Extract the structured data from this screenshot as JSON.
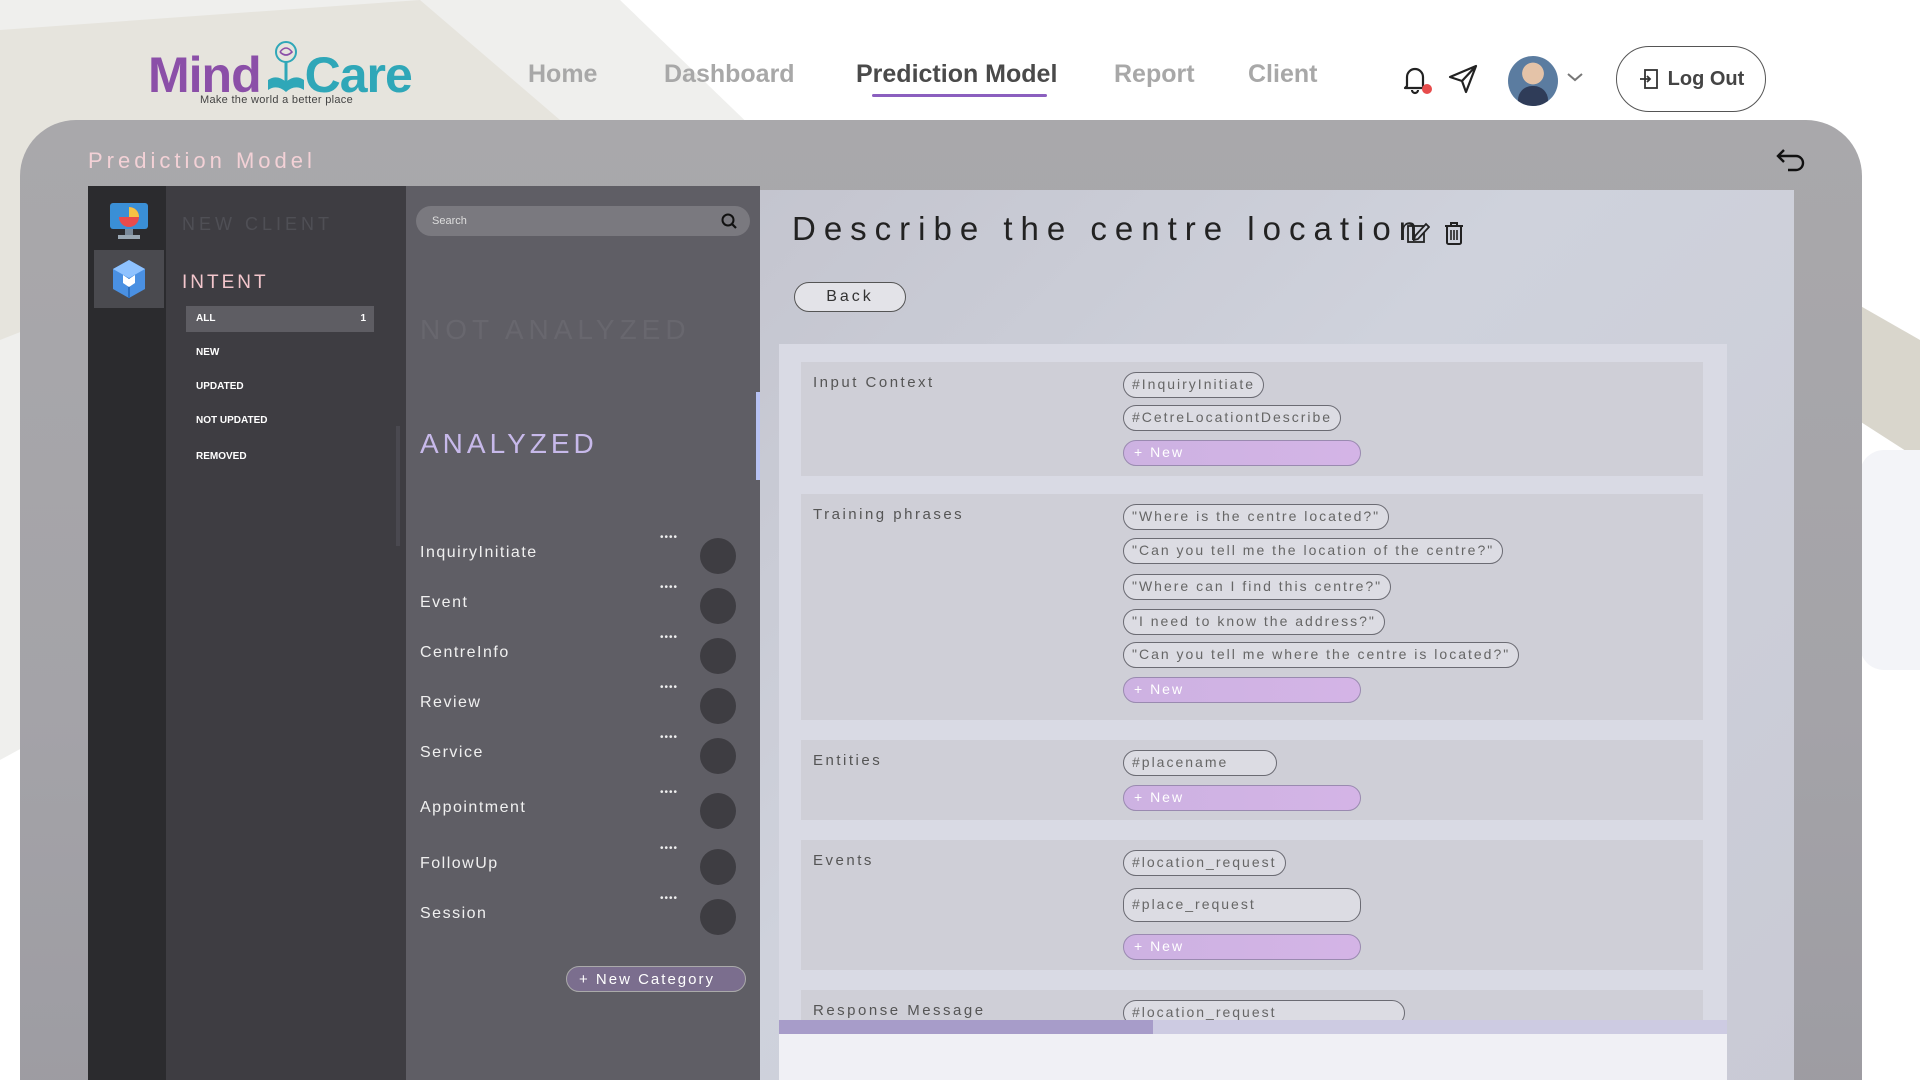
{
  "header": {
    "logo": {
      "word1": "Mind",
      "word2": "Care",
      "tagline": "Make the world a better place"
    },
    "nav": [
      {
        "label": "Home",
        "active": false
      },
      {
        "label": "Dashboard",
        "active": false
      },
      {
        "label": "Prediction Model",
        "active": true
      },
      {
        "label": "Report",
        "active": false
      },
      {
        "label": "Client",
        "active": false
      }
    ],
    "icons": {
      "notifications": "bell-icon",
      "messages": "send-icon",
      "profile_menu": "chevron-down-icon"
    },
    "logout_label": "Log Out"
  },
  "panel": {
    "title": "Prediction Model",
    "rail": [
      {
        "icon": "analytics-chart-icon",
        "active": false
      },
      {
        "icon": "cube-model-icon",
        "active": true
      }
    ]
  },
  "intent_sidebar": {
    "new_client_label": "NEW CLIENT",
    "intent_heading": "INTENT",
    "filters": [
      {
        "label": "ALL",
        "count": "1",
        "active": true
      },
      {
        "label": "NEW",
        "count": "",
        "active": false
      },
      {
        "label": "UPDATED",
        "count": "",
        "active": false
      },
      {
        "label": "NOT UPDATED",
        "count": "",
        "active": false
      },
      {
        "label": "REMOVED",
        "count": "",
        "active": false
      }
    ]
  },
  "categories": {
    "search_placeholder": "Search",
    "not_analyzed_heading": "NOT ANALYZED",
    "analyzed_heading": "ANALYZED",
    "items": [
      {
        "label": "InquiryInitiate",
        "dots": "••••"
      },
      {
        "label": "Event",
        "dots": "••••"
      },
      {
        "label": "CentreInfo",
        "dots": "••••"
      },
      {
        "label": "Review",
        "dots": "••••"
      },
      {
        "label": "Service",
        "dots": "••••"
      },
      {
        "label": "Appointment",
        "dots": "••••"
      },
      {
        "label": "FollowUp",
        "dots": "••••"
      },
      {
        "label": "Session",
        "dots": "••••"
      }
    ],
    "new_category_label": "+ New Category"
  },
  "detail": {
    "title": "Describe the centre location",
    "back_label": "Back",
    "new_label": "+ New",
    "sections": {
      "input_context": {
        "label": "Input Context",
        "chips": [
          "#InquiryInitiate",
          "#CetreLocationtDescribe"
        ]
      },
      "training_phrases": {
        "label": "Training phrases",
        "chips": [
          "\"Where is the centre located?\"",
          "\"Can you tell me the location of the centre?\"",
          "\"Where can I find this centre?\"",
          "\"I need to know the address?\"",
          "\"Can you tell me where the centre is located?\""
        ]
      },
      "entities": {
        "label": "Entities",
        "chips": [
          "#placename"
        ]
      },
      "events": {
        "label": "Events",
        "chips": [
          "#location_request",
          "#place_request"
        ]
      },
      "response_message": {
        "label": "Response Message",
        "chips": [
          "#location_request"
        ]
      }
    }
  },
  "colors": {
    "brand_purple": "#8b4fa8",
    "brand_teal": "#2fa7b8",
    "accent_pink": "#f3c6cc",
    "accent_lavender": "#c7b9ea",
    "notification": "#e74c4c"
  }
}
